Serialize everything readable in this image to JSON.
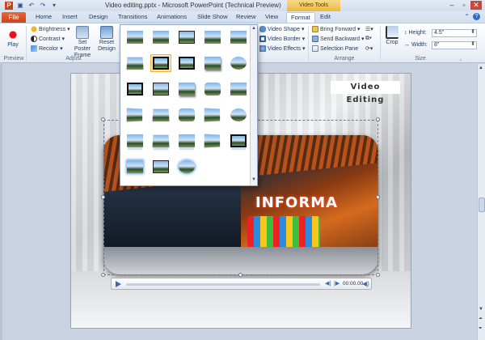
{
  "titlebar": {
    "title": "Video editing.pptx - Microsoft PowerPoint (Technical Preview)",
    "context_group": "Video Tools",
    "qat_icons": [
      "powerpoint-logo-icon",
      "save-icon",
      "undo-icon",
      "redo-icon",
      "qat-dropdown-icon"
    ],
    "window_buttons": [
      "–",
      "▫",
      "✕"
    ]
  },
  "tabs": {
    "file": "File",
    "items": [
      "Home",
      "Insert",
      "Design",
      "Transitions",
      "Animations",
      "Slide Show",
      "Review",
      "View",
      "Format",
      "Edit"
    ],
    "active": "Format"
  },
  "ribbon": {
    "preview": {
      "group": "Preview",
      "play": "Play"
    },
    "adjust": {
      "group": "Adjust",
      "brightness": "Brightness",
      "contrast": "Contrast",
      "recolor": "Recolor",
      "set_poster_frame": "Set Poster Frame",
      "reset_design": "Reset Design"
    },
    "video_styles": {
      "video_shape": "Video Shape",
      "video_border": "Video Border",
      "video_effects": "Video Effects"
    },
    "arrange": {
      "group": "Arrange",
      "bring_forward": "Bring Forward",
      "send_backward": "Send Backward",
      "selection_pane": "Selection Pane"
    },
    "size": {
      "group": "Size",
      "crop": "Crop",
      "height_label": "Height:",
      "height_value": "4.5\"",
      "width_label": "Width:",
      "width_value": "8\""
    }
  },
  "slide": {
    "banner": "Video Editing",
    "video_sign": "INFORMA"
  },
  "player": {
    "time": "00:00.00"
  },
  "colors": {
    "file_tab": "#d4552a",
    "context_group": "#f0c24c",
    "ribbon_text": "#1e395b"
  }
}
